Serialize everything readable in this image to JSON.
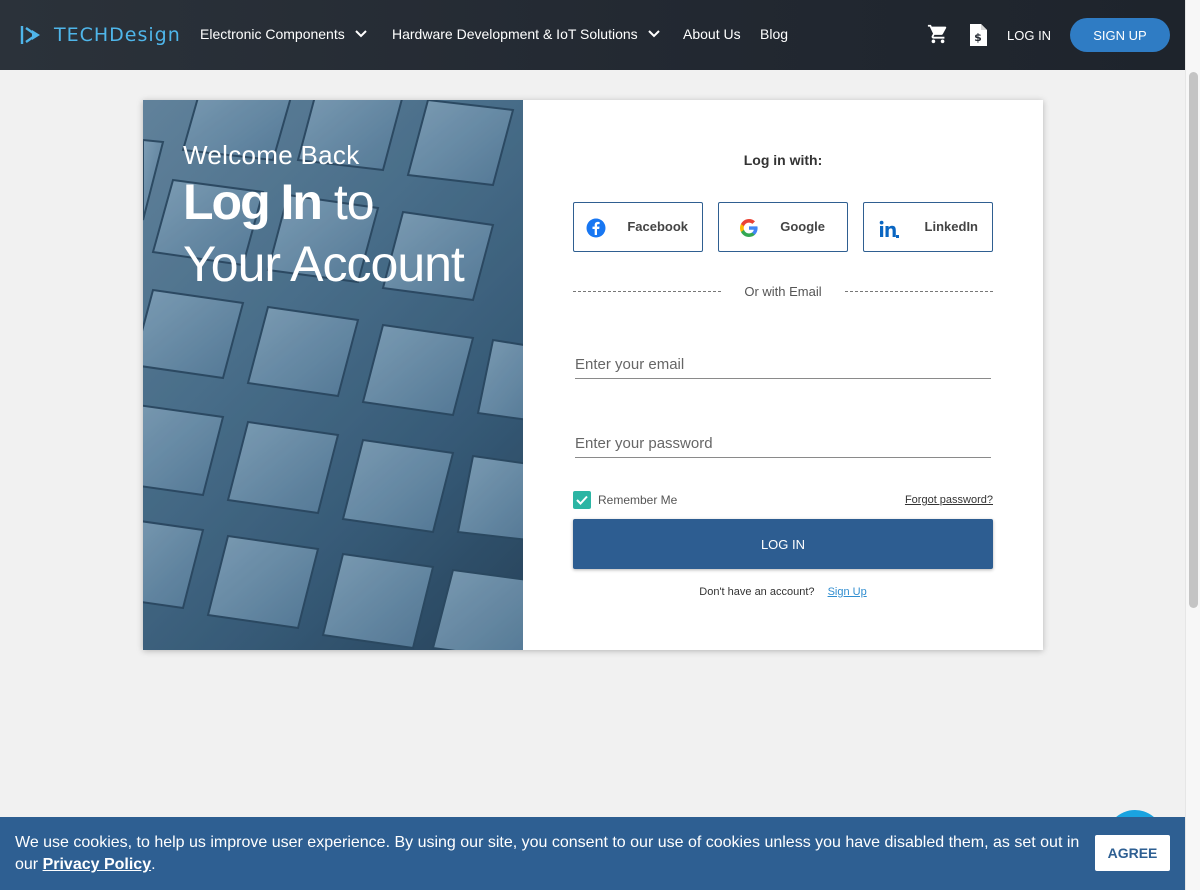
{
  "header": {
    "logo_text": "TECHDesign",
    "nav": [
      {
        "label": "Electronic Components",
        "has_dropdown": true
      },
      {
        "label": "Hardware Development & IoT Solutions",
        "has_dropdown": true
      },
      {
        "label": "About Us",
        "has_dropdown": false
      },
      {
        "label": "Blog",
        "has_dropdown": false
      }
    ],
    "cart_icon": "cart-icon",
    "quote_icon": "quote-document-icon",
    "login_label": "LOG IN",
    "signup_label": "SIGN UP"
  },
  "hero": {
    "welcome": "Welcome Back",
    "line1_bold": "Log In",
    "line1_rest": " to",
    "line2": "Your Account"
  },
  "form": {
    "login_with": "Log in with:",
    "social": [
      {
        "label": "Facebook",
        "icon": "facebook-icon"
      },
      {
        "label": "Google",
        "icon": "google-icon"
      },
      {
        "label": "LinkedIn",
        "icon": "linkedin-icon"
      }
    ],
    "or_with_email": "Or with Email",
    "email_placeholder": "Enter your email",
    "password_placeholder": "Enter your password",
    "remember_label": "Remember Me",
    "remember_checked": true,
    "forgot_label": "Forgot password?",
    "submit_label": "LOG IN",
    "no_account_text": "Don't have an account?",
    "signup_link": "Sign Up"
  },
  "cookie": {
    "text": "We use cookies, to help us improve user experience. By using our site, you consent to our use of cookies unless you have disabled them, as set out in our ",
    "policy_link": "Privacy Policy",
    "suffix": ".",
    "agree_label": "AGREE"
  },
  "colors": {
    "header_bg": "#252b33",
    "brand_blue": "#2f7cc4",
    "button_blue": "#2d5d91",
    "cookie_bg": "#2e5f92",
    "checkbox": "#2cb5a4"
  }
}
